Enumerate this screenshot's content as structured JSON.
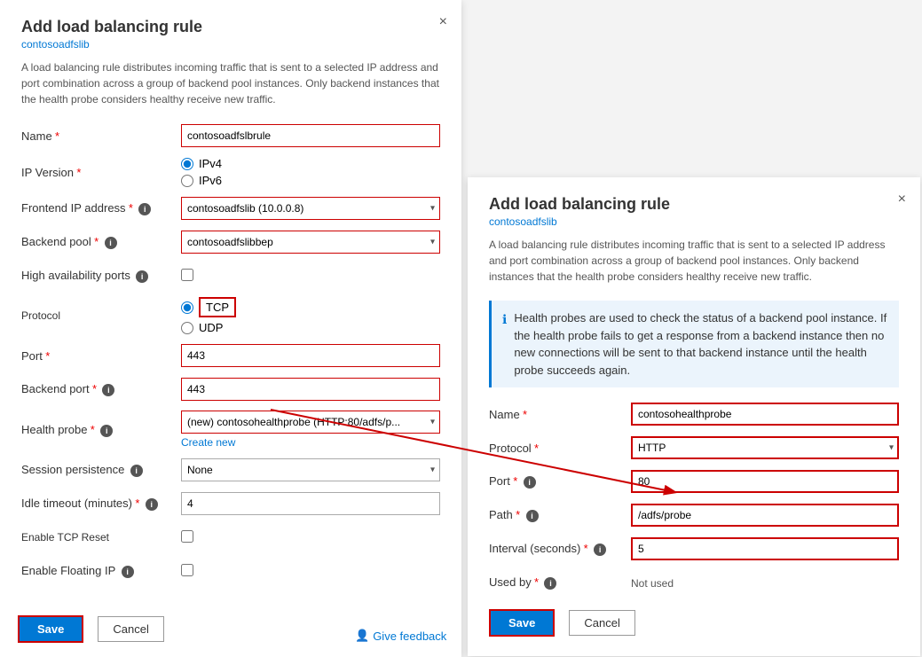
{
  "leftPanel": {
    "title": "Add load balancing rule",
    "subtitle": "contosoadfslib",
    "description": "A load balancing rule distributes incoming traffic that is sent to a selected IP address and port combination across a group of backend pool instances. Only backend instances that the health probe considers healthy receive new traffic.",
    "fields": {
      "name_label": "Name",
      "name_value": "contosoadfslbrule",
      "ip_version_label": "IP Version",
      "ipv4_label": "IPv4",
      "ipv6_label": "IPv6",
      "frontend_ip_label": "Frontend IP address",
      "frontend_ip_value": "contosoadfslib (10.0.0.8)",
      "backend_pool_label": "Backend pool",
      "backend_pool_value": "contosoadfslibbep",
      "high_avail_label": "High availability ports",
      "protocol_label": "Protocol",
      "tcp_label": "TCP",
      "udp_label": "UDP",
      "port_label": "Port",
      "port_value": "443",
      "backend_port_label": "Backend port",
      "backend_port_value": "443",
      "health_probe_label": "Health probe",
      "health_probe_value": "(new) contosohealthprobe (HTTP:80/adfs/p...",
      "create_new_label": "Create new",
      "session_persistence_label": "Session persistence",
      "session_persistence_value": "None",
      "idle_timeout_label": "Idle timeout (minutes)",
      "idle_timeout_value": "4",
      "enable_tcp_reset_label": "Enable TCP Reset",
      "enable_floating_ip_label": "Enable Floating IP"
    },
    "footer": {
      "save_label": "Save",
      "cancel_label": "Cancel",
      "feedback_label": "Give feedback"
    }
  },
  "rightPanel": {
    "title": "Add load balancing rule",
    "subtitle": "contosoadfslib",
    "description": "A load balancing rule distributes incoming traffic that is sent to a selected IP address and port combination across a group of backend pool instances. Only backend instances that the health probe considers healthy receive new traffic.",
    "info_box": "Health probes are used to check the status of a backend pool instance. If the health probe fails to get a response from a backend instance then no new connections will be sent to that backend instance until the health probe succeeds again.",
    "fields": {
      "name_label": "Name",
      "name_value": "contosohealthprobe",
      "protocol_label": "Protocol",
      "protocol_value": "HTTP",
      "port_label": "Port",
      "port_value": "80",
      "path_label": "Path",
      "path_value": "/adfs/probe",
      "interval_label": "Interval (seconds)",
      "interval_value": "5",
      "used_by_label": "Used by",
      "used_by_value": "Not used"
    },
    "footer": {
      "save_label": "Save",
      "cancel_label": "Cancel"
    }
  },
  "icons": {
    "close": "×",
    "chevron_down": "▾",
    "info": "i",
    "feedback": "👤"
  }
}
